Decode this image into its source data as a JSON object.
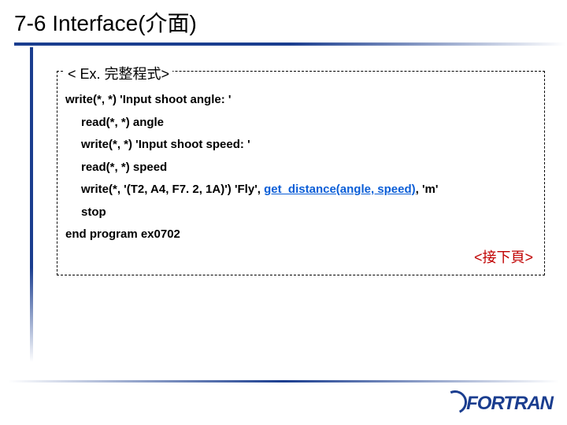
{
  "title": "7-6 Interface(介面)",
  "box_label": "< Ex. 完整程式>",
  "code": {
    "l1": "write(*, *) 'Input shoot angle: '",
    "l2": "read(*, *) angle",
    "l3": "write(*, *) 'Input shoot speed: '",
    "l4": "read(*, *) speed",
    "l5a": "write(*, '(T2, A4, F7. 2, 1A)') 'Fly', ",
    "l5b": "get_distance(angle, speed)",
    "l5c": ", 'm'",
    "l6": "stop",
    "l7": "end program ex0702"
  },
  "next_page": "<接下頁>",
  "logo_text": "FORTRAN"
}
